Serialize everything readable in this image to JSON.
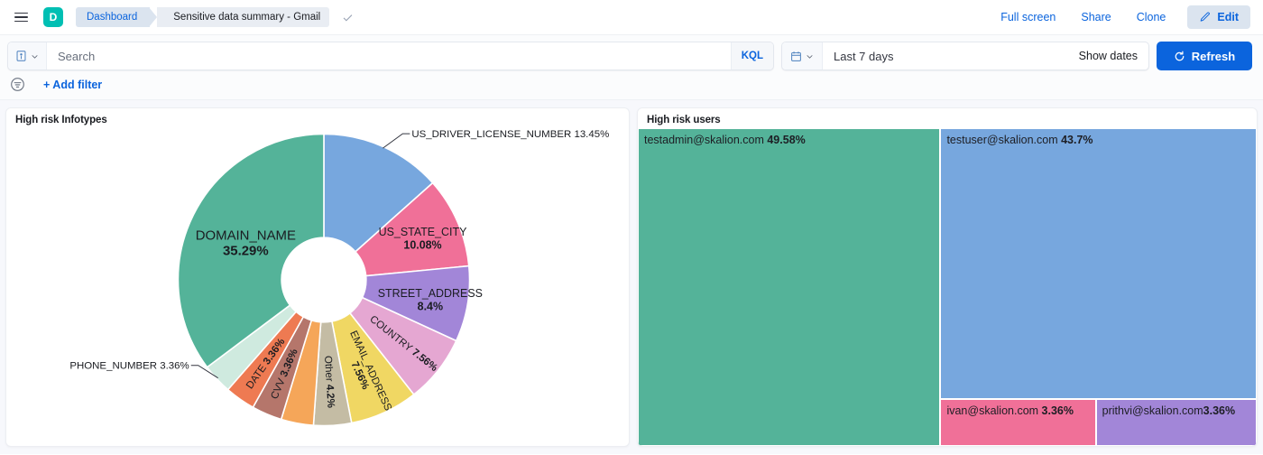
{
  "topnav": {
    "menu_icon": "hamburger-menu-icon",
    "app_badge": "D",
    "breadcrumb_root": "Dashboard",
    "breadcrumb_current": "Sensitive data summary - Gmail",
    "check_icon": "check-icon",
    "links": [
      "Full screen",
      "Share",
      "Clone"
    ],
    "edit_label": "Edit",
    "edit_icon": "pencil-icon"
  },
  "query": {
    "dataview_icon": "dataview-icon",
    "search_placeholder": "Search",
    "search_value": "",
    "kql_label": "KQL",
    "calendar_icon": "calendar-icon",
    "date_range": "Last 7 days",
    "show_dates_label": "Show dates",
    "refresh_label": "Refresh",
    "refresh_icon": "refresh-icon"
  },
  "filters": {
    "filter_icon": "filter-icon",
    "add_filter_label": "+ Add filter"
  },
  "panels": {
    "left_title": "High risk Infotypes",
    "right_title": "High risk users"
  },
  "chart_data": [
    {
      "type": "pie",
      "title": "High risk Infotypes",
      "variant": "donut",
      "label_format": "name percent",
      "categories": [
        "DOMAIN_NAME",
        "US_DRIVER_LICENSE_NUMBER",
        "US_STATE_CITY",
        "STREET_ADDRESS",
        "COUNTRY",
        "EMAIL_ADDRESS",
        "Other",
        "CVV",
        "DATE",
        "PHONE_NUMBER"
      ],
      "values": [
        35.29,
        13.45,
        10.08,
        8.4,
        7.56,
        7.56,
        4.2,
        3.36,
        3.36,
        3.36
      ],
      "labels": [
        "DOMAIN_NAME 35.29%",
        "US_DRIVER_LICENSE_NUMBER 13.45%",
        "US_STATE_CITY 10.08%",
        "STREET_ADDRESS 8.4%",
        "COUNTRY 7.56%",
        "EMAIL_ADDRESS 7.56%",
        "Other 4.2%",
        "CVV 3.36%",
        "DATE 3.36%",
        "PHONE_NUMBER 3.36%"
      ],
      "colors": [
        "#54B399",
        "#6F9FD8",
        "#EE789D",
        "#A987D1",
        "#E4A6C7",
        "#F1D86F",
        "#D6BF57",
        "#B9A888",
        "#F5A35C",
        "#CA8EAE",
        "#9A6F56",
        "#E7664C",
        "#C5D8C1"
      ],
      "slice_colors": {
        "DOMAIN_NAME": "#54B399",
        "US_DRIVER_LICENSE_NUMBER": "#77A7DE",
        "US_STATE_CITY": "#F07098",
        "STREET_ADDRESS": "#A286D8",
        "COUNTRY": "#E5A7D2",
        "EMAIL_ADDRESS": "#F0D763",
        "Other": "#C4BCA4",
        "UNLABELED": "#F5A659",
        "CVV": "#B5766B",
        "DATE": "#EE7A52",
        "PHONE_NUMBER": "#CFEADF"
      },
      "legend": "none"
    },
    {
      "type": "treemap",
      "title": "High risk users",
      "categories": [
        "testadmin@skalion.com",
        "testuser@skalion.com",
        "ivan@skalion.com",
        "prithvi@skalion.com"
      ],
      "values": [
        49.58,
        43.7,
        3.36,
        3.36
      ],
      "labels": [
        "testadmin@skalion.com 49.58%",
        "testuser@skalion.com 43.7%",
        "ivan@skalion.com 3.36%",
        "prithvi@skalion.com 3.36%"
      ],
      "percent_text": [
        "49.58%",
        "43.7%",
        "3.36%",
        "3.36%"
      ],
      "name_text": [
        "testadmin@skalion.com ",
        "testuser@skalion.com ",
        "ivan@skalion.com ",
        "prithvi@skalion.com"
      ],
      "colors": [
        "#54B399",
        "#77A7DE",
        "#F07098",
        "#A286D8"
      ],
      "legend": "none"
    }
  ],
  "theme": {
    "accent": "#0b64dd",
    "brand_teal": "#00BFB3",
    "page_bg": "#f7f8fc"
  }
}
